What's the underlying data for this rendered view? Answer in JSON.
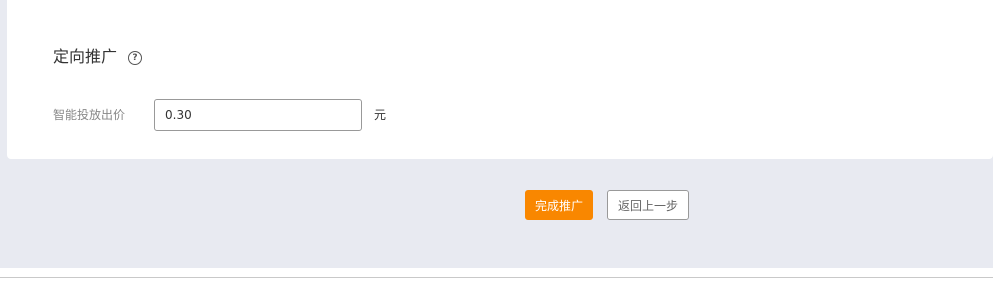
{
  "section": {
    "title": "定向推广",
    "help_icon": "question-circle-icon"
  },
  "bid": {
    "label": "智能投放出价",
    "value": "0.30",
    "unit": "元"
  },
  "actions": {
    "complete_label": "完成推广",
    "back_label": "返回上一步"
  },
  "colors": {
    "primary": "#f98700",
    "background": "#e8eaf1",
    "card": "#ffffff"
  }
}
